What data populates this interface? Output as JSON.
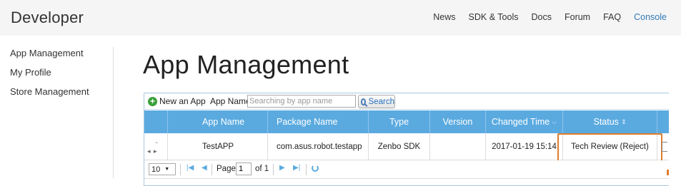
{
  "header": {
    "brand": "Developer",
    "nav": [
      "News",
      "SDK & Tools",
      "Docs",
      "Forum",
      "FAQ",
      "Console"
    ],
    "active_nav": "Console"
  },
  "sidebar": {
    "items": [
      {
        "label": "App Management"
      },
      {
        "label": "My Profile"
      },
      {
        "label": "Store Management"
      }
    ]
  },
  "main": {
    "title": "App Management"
  },
  "toolbar": {
    "new_app_label": "New an App",
    "app_name_label": "App Name",
    "search_placeholder": "Searching by app name",
    "search_button_label": "Search"
  },
  "table": {
    "columns": [
      "App Name",
      "Package Name",
      "Type",
      "Version",
      "Changed Time",
      "Status"
    ],
    "rows": [
      {
        "app_name": "TestAPP",
        "package_name": "com.asus.robot.testapp",
        "type": "Zenbo SDK",
        "version": "",
        "changed_time": "2017-01-19 15:14",
        "status": "Tech Review (Reject)"
      }
    ]
  },
  "pager": {
    "rows_per_page": "10",
    "page_label": "Page",
    "current_page": "1",
    "of_label": "of 1"
  },
  "colors": {
    "header_bg": "#f5f5f5",
    "accent_link": "#337ab7",
    "grid_header_bg": "#5aaae0",
    "highlight": "#e07d2c"
  }
}
